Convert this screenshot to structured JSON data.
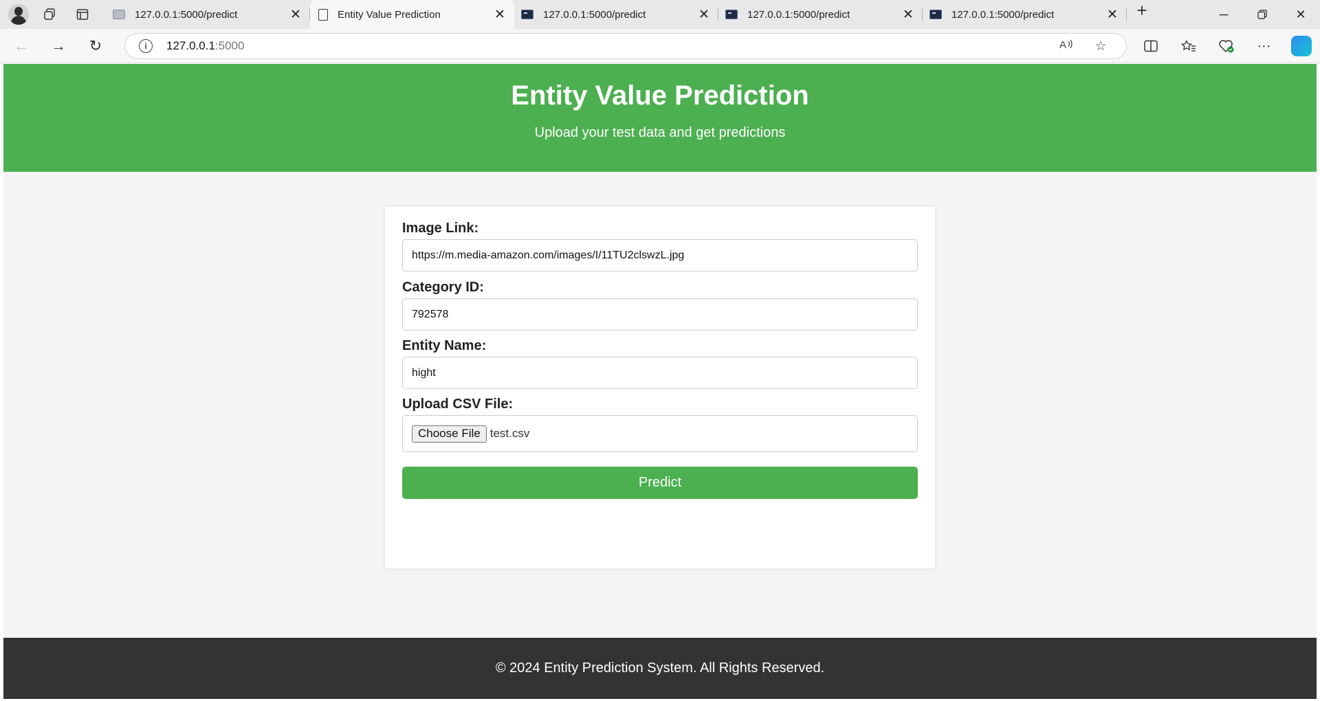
{
  "browser": {
    "tabs": [
      {
        "title": "127.0.0.1:5000/predict",
        "favicon": "gray-page-icon",
        "active": false
      },
      {
        "title": "Entity Value Prediction",
        "favicon": "document-icon",
        "active": true
      },
      {
        "title": "127.0.0.1:5000/predict",
        "favicon": "terminal-icon",
        "active": false
      },
      {
        "title": "127.0.0.1:5000/predict",
        "favicon": "terminal-icon",
        "active": false
      },
      {
        "title": "127.0.0.1:5000/predict",
        "favicon": "terminal-icon",
        "active": false
      }
    ],
    "url_host": "127.0.0.1",
    "url_port": ":5000"
  },
  "header": {
    "title": "Entity Value Prediction",
    "subtitle": "Upload your test data and get predictions"
  },
  "form": {
    "image_link_label": "Image Link:",
    "image_link_value": "https://m.media-amazon.com/images/I/11TU2clswzL.jpg",
    "category_label": "Category ID:",
    "category_value": "792578",
    "entity_label": "Entity Name:",
    "entity_value": "hight",
    "csv_label": "Upload CSV File:",
    "choose_file_label": "Choose File",
    "file_name": "test.csv",
    "submit_label": "Predict"
  },
  "footer": {
    "text": "© 2024 Entity Prediction System. All Rights Reserved."
  },
  "colors": {
    "accent": "#4caf50",
    "footer_bg": "#333333",
    "page_bg": "#f4f4f4"
  }
}
